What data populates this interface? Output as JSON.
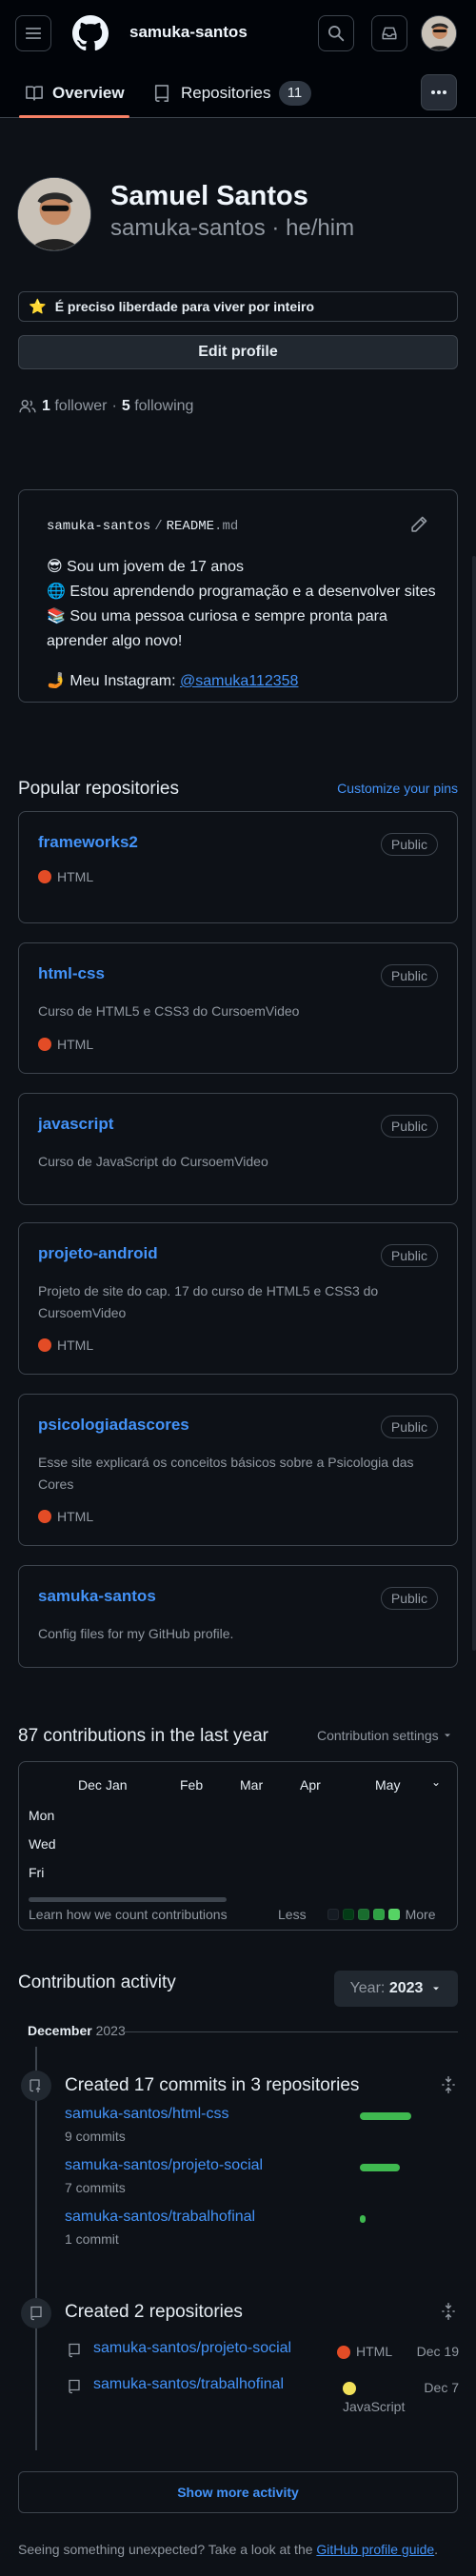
{
  "header": {
    "username": "samuka-santos"
  },
  "tabs": [
    {
      "label": "Overview"
    },
    {
      "label": "Repositories",
      "count": "11"
    }
  ],
  "profile": {
    "name": "Samuel Santos",
    "login_line": "samuka-santos · he/him",
    "status_emoji": "⭐",
    "status": "É preciso liberdade para viver por inteiro",
    "edit_label": "Edit profile",
    "followers_count": "1",
    "followers_label": "follower",
    "sep": "·",
    "following_count": "5",
    "following_label": "following"
  },
  "readme": {
    "owner": "samuka-santos",
    "slash": "/",
    "file": "README",
    "ext": ".md",
    "lines": [
      {
        "emoji": "😎",
        "text": "Sou um jovem de 17 anos"
      },
      {
        "emoji": "🌐",
        "text": "Estou aprendendo programação e a desenvolver sites"
      },
      {
        "emoji": "📚",
        "text": "Sou uma pessoa curiosa e sempre pronta para aprender algo novo!"
      }
    ],
    "insta_emoji": "🤳",
    "insta_label": "Meu Instagram:",
    "insta_handle": "@samuka112358"
  },
  "popular": {
    "title": "Popular repositories",
    "customize": "Customize your pins",
    "repos": [
      {
        "name": "frameworks2",
        "visibility": "Public",
        "desc": "",
        "lang": "HTML"
      },
      {
        "name": "html-css",
        "visibility": "Public",
        "desc": "Curso de HTML5 e CSS3 do CursoemVideo",
        "lang": "HTML"
      },
      {
        "name": "javascript",
        "visibility": "Public",
        "desc": "Curso de JavaScript do CursoemVideo",
        "lang": ""
      },
      {
        "name": "projeto-android",
        "visibility": "Public",
        "desc": "Projeto de site do cap. 17 do curso de HTML5 e CSS3 do CursoemVideo",
        "lang": "HTML"
      },
      {
        "name": "psicologiadascores",
        "visibility": "Public",
        "desc": "Esse site explicará os conceitos básicos sobre a Psicologia das Cores",
        "lang": "HTML"
      },
      {
        "name": "samuka-santos",
        "visibility": "Public",
        "desc": "Config files for my GitHub profile.",
        "lang": ""
      }
    ],
    "html_color": "#e34c26",
    "js_color": "#f1e05a"
  },
  "contributions": {
    "title": "87 contributions in the last year",
    "settings": "Contribution settings",
    "months": [
      "Dec",
      "Jan",
      "Feb",
      "Mar",
      "Apr",
      "May"
    ],
    "days": [
      "Mon",
      "Wed",
      "Fri"
    ],
    "learn": "Learn how we count contributions",
    "less": "Less",
    "more": "More",
    "legend_colors": [
      "#151b23",
      "#033a16",
      "#196c2e",
      "#2ea043",
      "#56d364"
    ]
  },
  "activity": {
    "title": "Contribution activity",
    "year_label": "Year:",
    "year": "2023",
    "month": "December",
    "month_year": "2023",
    "commits_title": "Created 17 commits in 3 repositories",
    "commit_repos": [
      {
        "repo": "samuka-santos/html-css",
        "commits": "9 commits",
        "share": 0.53
      },
      {
        "repo": "samuka-santos/projeto-social",
        "commits": "7 commits",
        "share": 0.41
      },
      {
        "repo": "samuka-santos/trabalhofinal",
        "commits": "1 commit",
        "share": 0.06
      }
    ],
    "created_title": "Created 2 repositories",
    "created_repos": [
      {
        "repo": "samuka-santos/projeto-social",
        "lang": "HTML",
        "date": "Dec 19"
      },
      {
        "repo": "samuka-santos/trabalhofinal",
        "lang": "JavaScript",
        "date": "Dec 7"
      }
    ],
    "show_more": "Show more activity"
  },
  "footer": {
    "text": "Seeing something unexpected? Take a look at the",
    "link": "GitHub profile guide",
    "end": "."
  }
}
